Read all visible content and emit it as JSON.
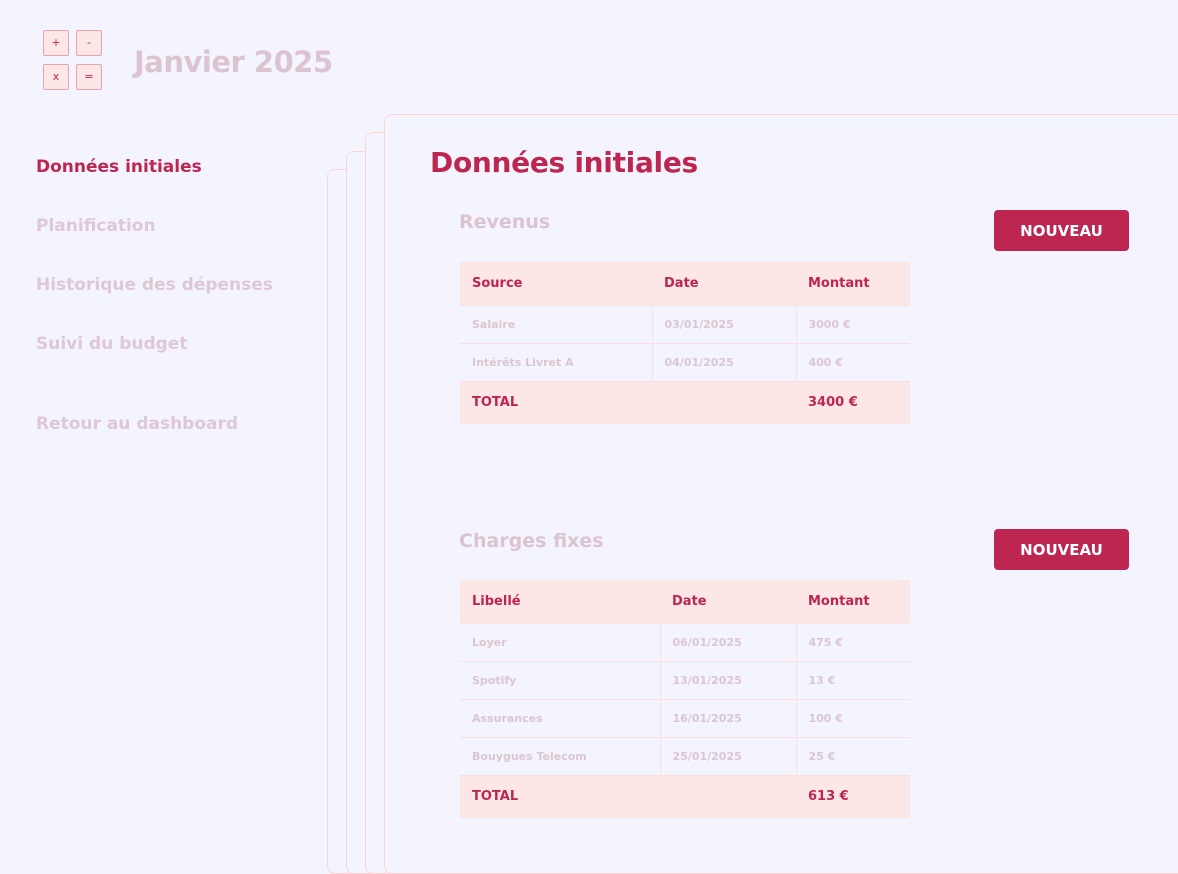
{
  "logo": {
    "keys": [
      "+",
      "-",
      "x",
      "="
    ]
  },
  "header": {
    "title": "Janvier 2025"
  },
  "sidebar": {
    "items": [
      {
        "label": "Données initiales"
      },
      {
        "label": "Planification"
      },
      {
        "label": "Historique des dépenses"
      },
      {
        "label": "Suivi du budget"
      },
      {
        "label": "Retour au dashboard"
      }
    ],
    "active_index": 0
  },
  "main": {
    "title": "Données initiales",
    "revenus": {
      "title": "Revenus",
      "button_label": "NOUVEAU",
      "columns": [
        "Source",
        "Date",
        "Montant"
      ],
      "rows": [
        [
          "Salaire",
          "03/01/2025",
          "3000 €"
        ],
        [
          "Intérêts Livret A",
          "04/01/2025",
          "400 €"
        ]
      ],
      "total_label": "TOTAL",
      "total_value": "3400 €"
    },
    "charges": {
      "title": "Charges fixes",
      "button_label": "NOUVEAU",
      "columns": [
        "Libellé",
        "Date",
        "Montant"
      ],
      "rows": [
        [
          "Loyer",
          "06/01/2025",
          "475 €"
        ],
        [
          "Spotify",
          "13/01/2025",
          "13 €"
        ],
        [
          "Assurances",
          "16/01/2025",
          "100 €"
        ],
        [
          "Bouygues Telecom",
          "25/01/2025",
          "25 €"
        ]
      ],
      "total_label": "TOTAL",
      "total_value": "613 €"
    }
  },
  "colors": {
    "accent": "#bd2650",
    "muted_text": "#dbc4cf",
    "table_header_bg": "#fce6e6",
    "page_bg": "#f4f4fe"
  }
}
